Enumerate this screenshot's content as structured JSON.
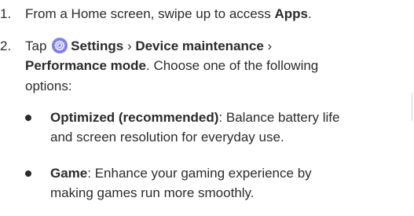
{
  "steps": [
    {
      "number": "1.",
      "before": "From a Home screen, swipe up to access ",
      "bold": "Apps",
      "after": "."
    },
    {
      "number": "2.",
      "tap": "Tap",
      "settings": "Settings",
      "sep1": " › ",
      "device_maintenance": "Device maintenance",
      "sep2": " ›",
      "performance_mode": "Performance mode",
      "choose": ". Choose one of the following",
      "options_word": "options:"
    }
  ],
  "bullets": [
    {
      "bold": "Optimized (recommended)",
      "line1_rest": ": Balance battery life",
      "line2": "and screen resolution for everyday use."
    },
    {
      "bold": "Game",
      "line1_rest": ": Enhance your gaming experience by",
      "line2": "making games run more smoothly."
    }
  ],
  "icons": {
    "settings": "gear-icon",
    "settings_color": "#7b7ff3"
  }
}
